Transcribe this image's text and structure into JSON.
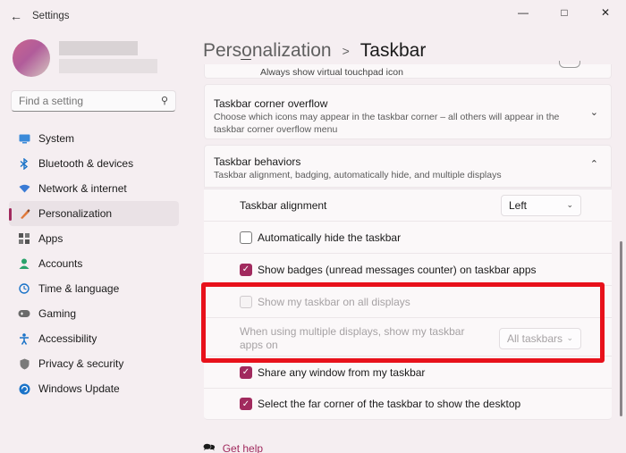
{
  "window": {
    "title": "Settings",
    "back_icon": "arrow-left-icon",
    "controls": [
      "minimize-icon",
      "maximize-icon",
      "close-icon"
    ]
  },
  "search": {
    "placeholder": "Find a setting"
  },
  "nav": {
    "items": [
      {
        "label": "System",
        "icon": "monitor-icon",
        "color": "#1a73c8"
      },
      {
        "label": "Bluetooth & devices",
        "icon": "bluetooth-icon",
        "color": "#1a73c8"
      },
      {
        "label": "Network & internet",
        "icon": "wifi-icon",
        "color": "#3a7bd5"
      },
      {
        "label": "Personalization",
        "icon": "brush-icon",
        "color": "#c5602a"
      },
      {
        "label": "Apps",
        "icon": "apps-icon",
        "color": "#555555"
      },
      {
        "label": "Accounts",
        "icon": "person-icon",
        "color": "#2aa36b"
      },
      {
        "label": "Time & language",
        "icon": "globe-clock-icon",
        "color": "#1a73c8"
      },
      {
        "label": "Gaming",
        "icon": "gamepad-icon",
        "color": "#6b6b6b"
      },
      {
        "label": "Accessibility",
        "icon": "accessibility-icon",
        "color": "#1a73c8"
      },
      {
        "label": "Privacy & security",
        "icon": "shield-icon",
        "color": "#6b6b6b"
      },
      {
        "label": "Windows Update",
        "icon": "refresh-icon",
        "color": "#1a73c8"
      }
    ],
    "selected_index": 3,
    "accent": "#a12a5e"
  },
  "breadcrumb": {
    "parent": "Personalization",
    "separator": ">",
    "current": "Taskbar"
  },
  "main": {
    "touchpad_row": {
      "label": "Always show virtual touchpad icon"
    },
    "corner_overflow": {
      "title": "Taskbar corner overflow",
      "subtitle": "Choose which icons may appear in the taskbar corner – all others will appear in the taskbar corner overflow menu"
    },
    "behaviors": {
      "title": "Taskbar behaviors",
      "subtitle": "Taskbar alignment, badging, automatically hide, and multiple displays",
      "alignment_label": "Taskbar alignment",
      "alignment_value": "Left",
      "auto_hide_label": "Automatically hide the taskbar",
      "auto_hide_checked": false,
      "badges_label": "Show badges (unread messages counter) on taskbar apps",
      "badges_checked": true,
      "all_displays_label": "Show my taskbar on all displays",
      "all_displays_checked": false,
      "multi_display_label": "When using multiple displays, show my taskbar apps on",
      "multi_display_value": "All taskbars",
      "share_window_label": "Share any window from my taskbar",
      "share_window_checked": true,
      "far_corner_label": "Select the far corner of the taskbar to show the desktop",
      "far_corner_checked": true
    },
    "highlight_color": "#e8111b"
  },
  "help": {
    "label": "Get help"
  }
}
